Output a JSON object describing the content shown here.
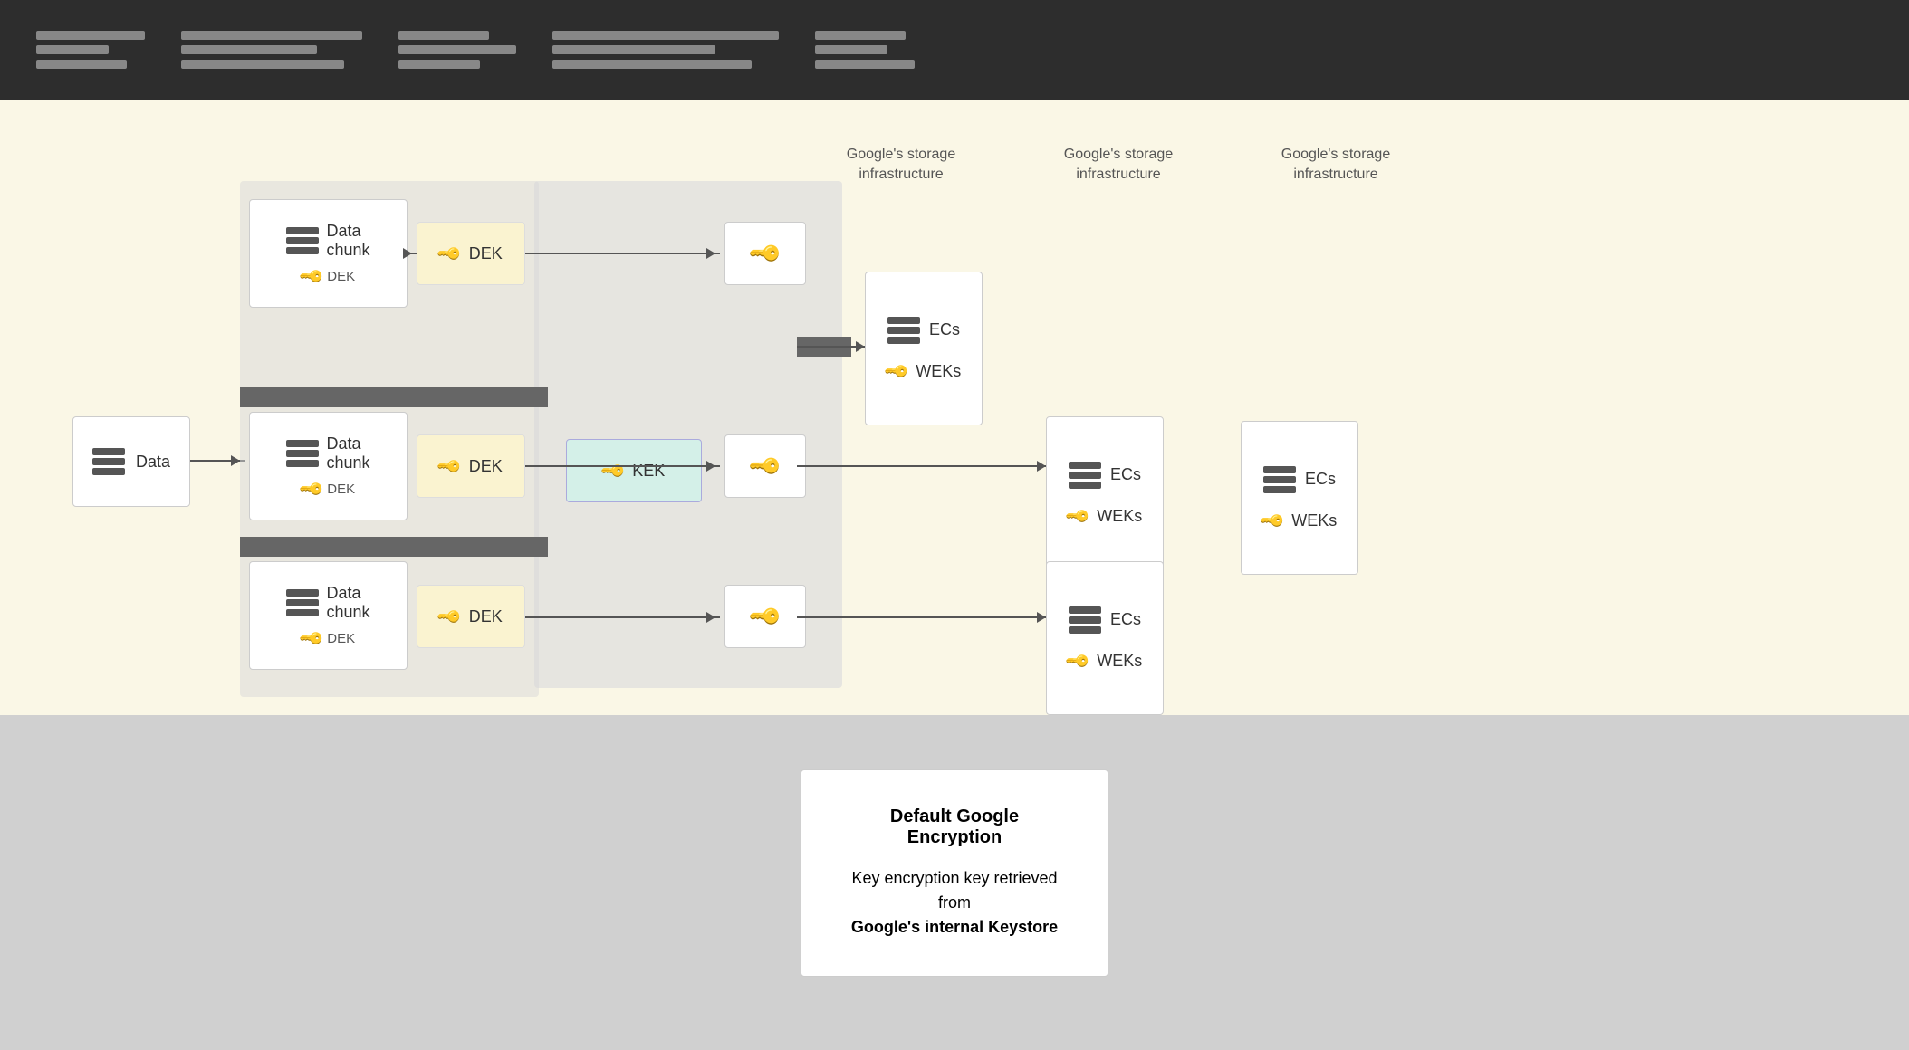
{
  "topBar": {
    "sections": [
      {
        "lines": [
          120,
          80,
          100
        ]
      },
      {
        "lines": [
          200,
          150,
          180
        ]
      },
      {
        "lines": [
          100,
          130,
          90
        ]
      },
      {
        "lines": [
          250,
          180,
          220
        ]
      },
      {
        "lines": [
          100,
          80,
          110
        ]
      }
    ]
  },
  "diagram": {
    "dataBox": {
      "label": "Data"
    },
    "chunks": [
      {
        "label": "Data",
        "sublabel": "chunk",
        "dek": "DEK"
      },
      {
        "label": "Data",
        "sublabel": "chunk",
        "dek": "DEK"
      },
      {
        "label": "Data",
        "sublabel": "chunk",
        "dek": "DEK"
      }
    ],
    "deks": [
      "DEK",
      "DEK",
      "DEK"
    ],
    "kek": {
      "label": "KEK"
    },
    "encryptedKeys": [
      {
        "label": ""
      },
      {
        "label": ""
      },
      {
        "label": ""
      }
    ],
    "infraLabel1": "Google's storage\ninfrastructure",
    "infraLabel2": "Google's storage\ninfrastructure",
    "infraLabel3": "Google's storage\ninfrastructure",
    "storageGroups": [
      {
        "ecs": "ECs",
        "weks": "WEKs"
      },
      {
        "ecs": "ECs",
        "weks": "WEKs"
      },
      {
        "ecs": "ECs",
        "weks": "WEKs"
      }
    ]
  },
  "legend": {
    "title": "Default Google Encryption",
    "description": "Key encryption key retrieved from",
    "descriptionBold": "Google's internal Keystore"
  }
}
